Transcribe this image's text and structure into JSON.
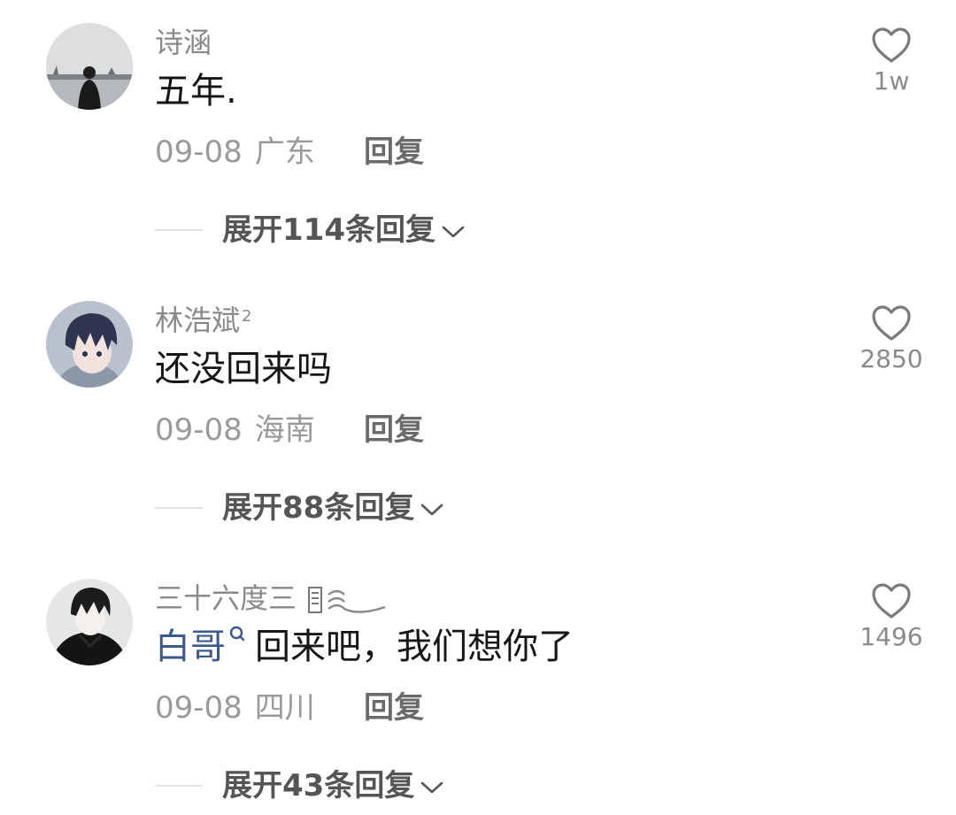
{
  "comments": [
    {
      "username": "诗涵",
      "badge": "",
      "content": "五年.",
      "date": "09-08",
      "location": "广东",
      "reply_label": "回复",
      "expand_label": "展开114条回复",
      "likes": "1w",
      "avatar": "avatar-lakeside-silhouette"
    },
    {
      "username": "林浩斌",
      "badge": "2",
      "content": "还没回来吗",
      "date": "09-08",
      "location": "海南",
      "reply_label": "回复",
      "expand_label": "展开88条回复",
      "likes": "2850",
      "avatar": "avatar-anime-boy-blue-hair"
    },
    {
      "username": "三十六度三",
      "badge": "",
      "mention": "白哥",
      "content": "回来吧，我们想你了",
      "date": "09-08",
      "location": "四川",
      "reply_label": "回复",
      "expand_label": "展开43条回复",
      "likes": "1496",
      "avatar": "avatar-anime-boy-black-coat"
    }
  ],
  "icons": {
    "like": "heart-outline-icon",
    "expand": "chevron-down-icon",
    "mention": "search-icon"
  },
  "colors": {
    "mention": "#3a5a8c",
    "username": "#8a8a8a",
    "meta": "#9a9a9a",
    "content": "#161616"
  }
}
